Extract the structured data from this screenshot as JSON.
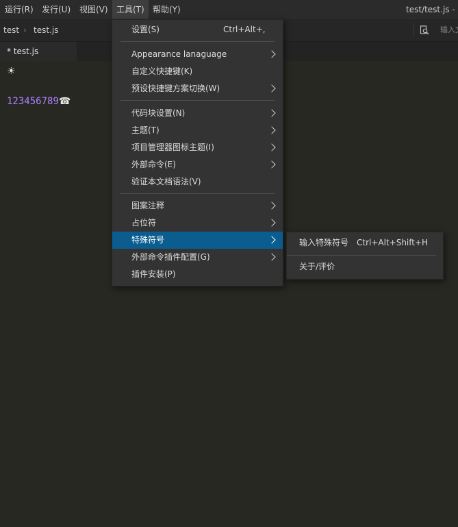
{
  "menubar": {
    "items": [
      "运行(R)",
      "发行(U)",
      "视图(V)",
      "工具(T)",
      "帮助(Y)"
    ],
    "window_title": "test/test.js - H"
  },
  "breadcrumb": {
    "items": [
      "test",
      "test.js"
    ]
  },
  "search": {
    "placeholder": "输入文"
  },
  "tabs": [
    {
      "label": "* test.js"
    }
  ],
  "editor": {
    "line1": "☀",
    "line2_digits": "123456789",
    "line2_icon": "☎"
  },
  "tools_menu": {
    "items": [
      {
        "label": "设置(S)",
        "shortcut": "Ctrl+Alt+,"
      },
      {
        "label": "Appearance lanaguage",
        "submenu": true
      },
      {
        "label": "自定义快捷键(K)"
      },
      {
        "label": "预设快捷键方案切换(W)",
        "submenu": true
      },
      {
        "label": "代码块设置(N)",
        "submenu": true
      },
      {
        "label": "主题(T)",
        "submenu": true
      },
      {
        "label": "项目管理器图标主题(I)",
        "submenu": true
      },
      {
        "label": "外部命令(E)",
        "submenu": true
      },
      {
        "label": "验证本文档语法(V)"
      },
      {
        "label": "图案注释",
        "submenu": true
      },
      {
        "label": "占位符",
        "submenu": true
      },
      {
        "label": "特殊符号",
        "submenu": true,
        "highlighted": true
      },
      {
        "label": "外部命令插件配置(G)",
        "submenu": true
      },
      {
        "label": "插件安装(P)"
      }
    ]
  },
  "special_symbols_submenu": {
    "items": [
      {
        "label": "输入特殊符号",
        "shortcut": "Ctrl+Alt+Shift+H"
      },
      {
        "label": "关于/评价"
      }
    ]
  },
  "colors": {
    "editor_bg": "#272822",
    "menu_bg": "#333333",
    "highlight": "#0b5c8f",
    "number_color": "#ae81ff"
  }
}
